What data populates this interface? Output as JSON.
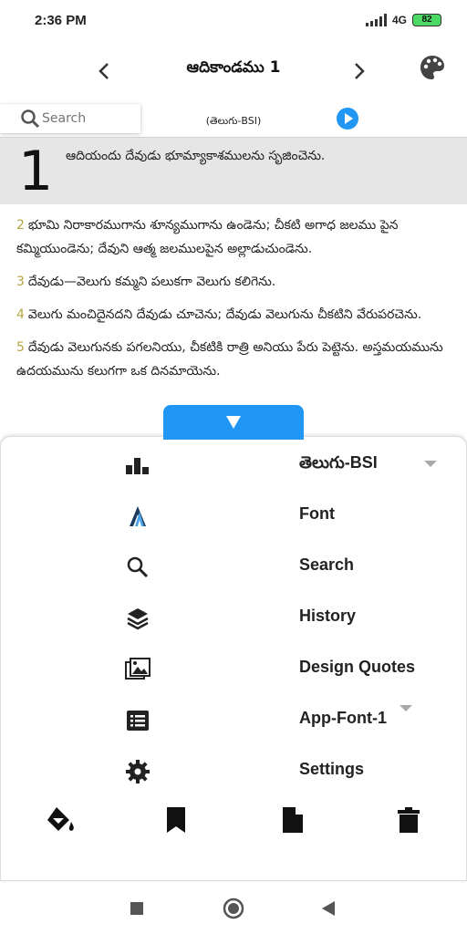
{
  "status_bar": {
    "time": "2:36 PM",
    "network": "4G",
    "battery": "82"
  },
  "header": {
    "title": "ఆదికాండము 1",
    "prev_icon": "chevron-left-icon",
    "next_icon": "chevron-right-icon",
    "palette_icon": "palette-icon"
  },
  "search": {
    "placeholder": "Search",
    "version_label": "(తెలుగు-BSI)"
  },
  "chapter": {
    "number": "1",
    "verse1": "ఆదియందు దేవుడు భూమ్యాకాశములను సృజించెను.",
    "verses": [
      {
        "num": "2",
        "text": "భూమి నిరాకారముగాను శూన్యముగాను ఉండెను; చీకటి అగాధ జలము పైన కమ్మియుండెను; దేవుని ఆత్మ జలములపైన అల్లాడుచుండెను."
      },
      {
        "num": "3",
        "text": "దేవుడు—వెలుగు కమ్మని పలుకగా వెలుగు కలిగెను."
      },
      {
        "num": "4",
        "text": "వెలుగు మంచిదైనదని దేవుడు చూచెను; దేవుడు వెలుగును చీకటిని వేరుపరచెను."
      },
      {
        "num": "5",
        "text": "దేవుడు వెలుగునకు పగలనియు, చీకటికి రాత్రి అనియు పేరు పెట్టెను. అస్తమయమును ఉదయమును కలుగగా ఒక దినమాయెను."
      }
    ]
  },
  "menu": {
    "items": [
      {
        "label": "తెలుగు-BSI",
        "icon": "bar-chart-icon"
      },
      {
        "label": "Font",
        "icon": "font-icon"
      },
      {
        "label": "Search",
        "icon": "search-icon"
      },
      {
        "label": "History",
        "icon": "layers-icon"
      },
      {
        "label": "Design Quotes",
        "icon": "images-icon"
      },
      {
        "label": "App-Font-1",
        "icon": "list-icon"
      },
      {
        "label": "Settings",
        "icon": "gear-icon"
      }
    ],
    "tools": [
      "paint-bucket-icon",
      "bookmark-icon",
      "file-icon",
      "trash-icon"
    ]
  },
  "colors": {
    "accent": "#2196f3",
    "verse_number": "#b5a642",
    "chapter_bg": "#e6e6e6"
  }
}
